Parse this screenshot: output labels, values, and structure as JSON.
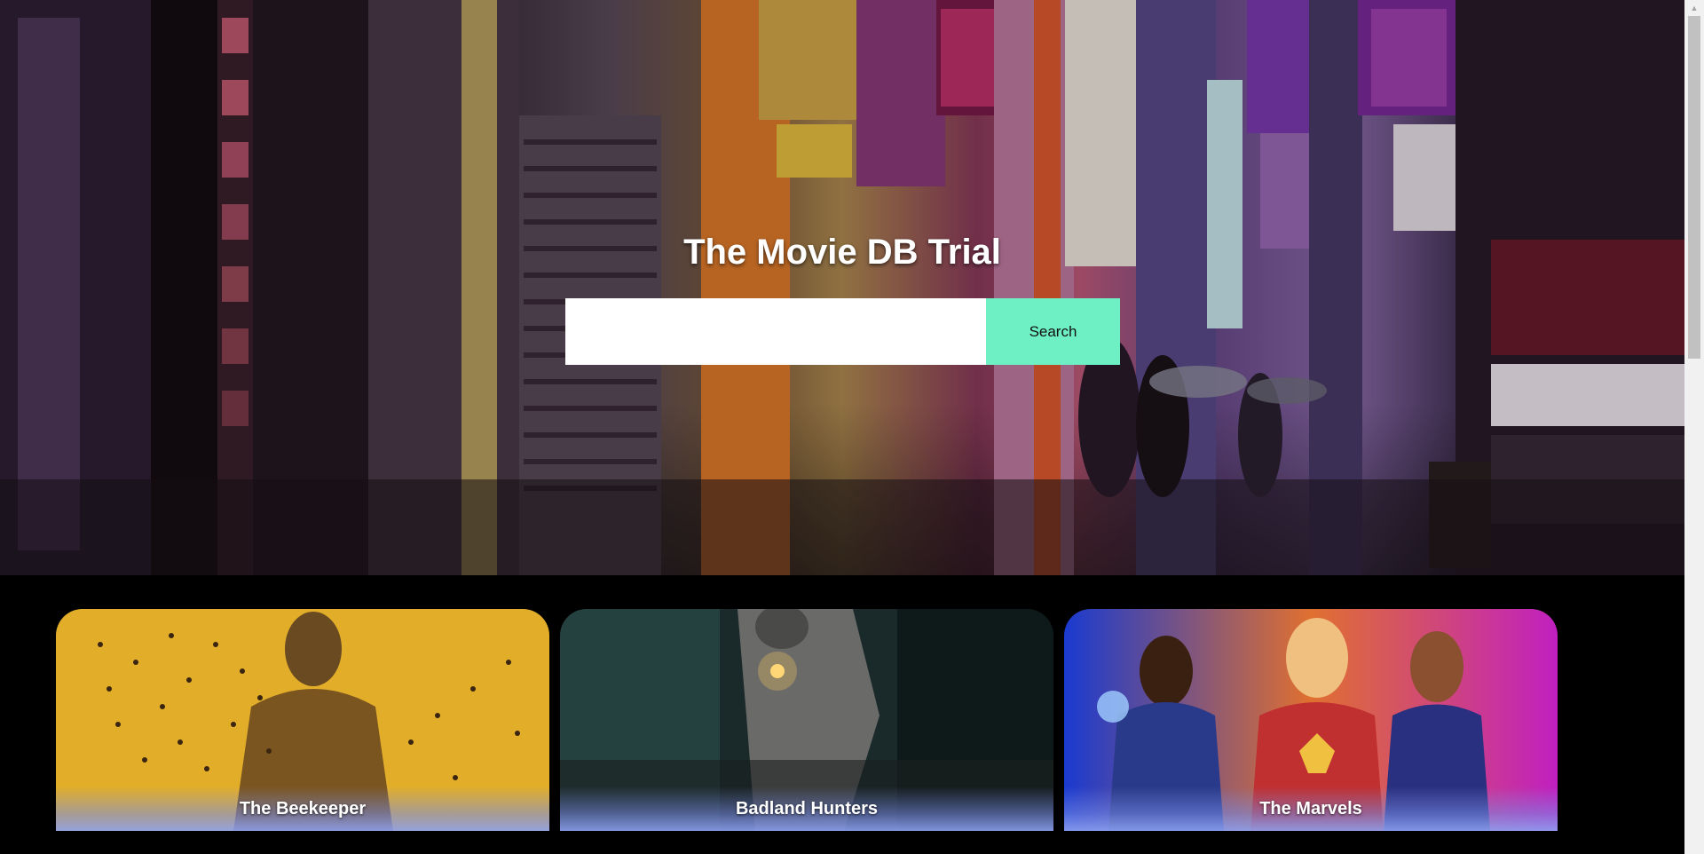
{
  "page": {
    "title": "The Movie DB Trial"
  },
  "search": {
    "value": "",
    "placeholder": "",
    "button_label": "Search"
  },
  "movies": [
    {
      "title": "The Beekeeper"
    },
    {
      "title": "Badland Hunters"
    },
    {
      "title": "The Marvels"
    }
  ],
  "colors": {
    "background": "#000000",
    "search_button": "#6ef0c4",
    "title_text": "#ffffff"
  }
}
